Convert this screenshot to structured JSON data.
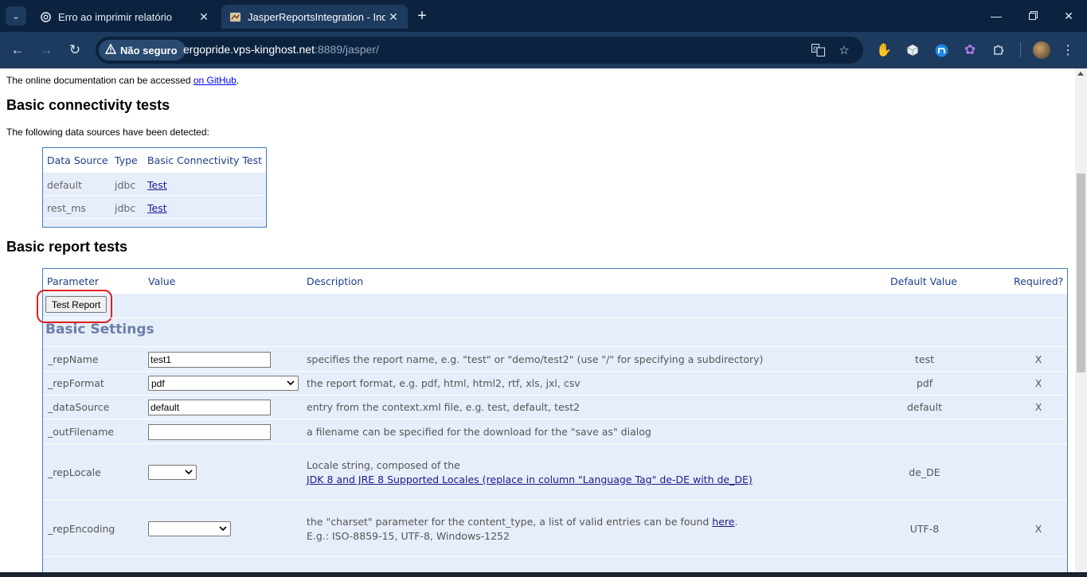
{
  "browser": {
    "tabs": [
      {
        "title": "Erro ao imprimir relatório",
        "favicon": "openai-icon",
        "active": false
      },
      {
        "title": "JasperReportsIntegration - Inde",
        "favicon": "jasper-icon",
        "active": true
      }
    ],
    "security_label": "Não seguro",
    "url_host": "ergopride.vps-kinghost.net",
    "url_path": ":8889/jasper/",
    "extensions": [
      "red-hand-icon",
      "cube-icon",
      "blue-circle-icon",
      "purple-gear-icon",
      "puzzle-icon"
    ]
  },
  "page": {
    "doc_prefix": "The online documentation can be accessed ",
    "doc_link": "on GitHub",
    "doc_suffix": ".",
    "connectivity_title": "Basic connectivity tests",
    "detected_text": "The following data sources have been detected:",
    "datasource_table": {
      "headers": [
        "Data Source",
        "Type",
        "Basic Connectivity Test"
      ],
      "rows": [
        {
          "source": "default",
          "type": "jdbc",
          "test": "Test"
        },
        {
          "source": "rest_ms",
          "type": "jdbc",
          "test": "Test"
        }
      ]
    },
    "report_title": "Basic report tests",
    "report_table": {
      "headers": [
        "Parameter",
        "Value",
        "Description",
        "Default Value",
        "Required?"
      ],
      "test_button": "Test Report",
      "section": "Basic Settings",
      "rows": [
        {
          "param": "_repName",
          "value": "test1",
          "desc": "specifies the report name, e.g. \"test\" or \"demo/test2\" (use \"/\" for specifying a subdirectory)",
          "default": "test",
          "required": "X"
        },
        {
          "param": "_repFormat",
          "value": "pdf",
          "desc": "the report format, e.g. pdf, html, html2, rtf, xls, jxl, csv",
          "default": "pdf",
          "required": "X"
        },
        {
          "param": "_dataSource",
          "value": "default",
          "desc": "entry from the context.xml file, e.g. test, default, test2",
          "default": "default",
          "required": "X"
        },
        {
          "param": "_outFilename",
          "value": "",
          "desc": "a filename can be specified for the download for the \"save as\" dialog",
          "default": "",
          "required": ""
        },
        {
          "param": "_repLocale",
          "value": "",
          "desc": "Locale string, composed of the",
          "desc_link": "JDK 8 and JRE 8 Supported Locales (replace in column \"Language Tag\" de-DE with de_DE)",
          "default": "de_DE",
          "required": ""
        },
        {
          "param": "_repEncoding",
          "value": "",
          "desc": "the \"charset\" parameter for the content_type, a list of valid entries can be found ",
          "desc_link": "here",
          "desc_after": ".",
          "desc2": "E.g.: ISO-8859-15, UTF-8, Windows-1252",
          "default": "UTF-8",
          "required": "X"
        }
      ]
    }
  }
}
